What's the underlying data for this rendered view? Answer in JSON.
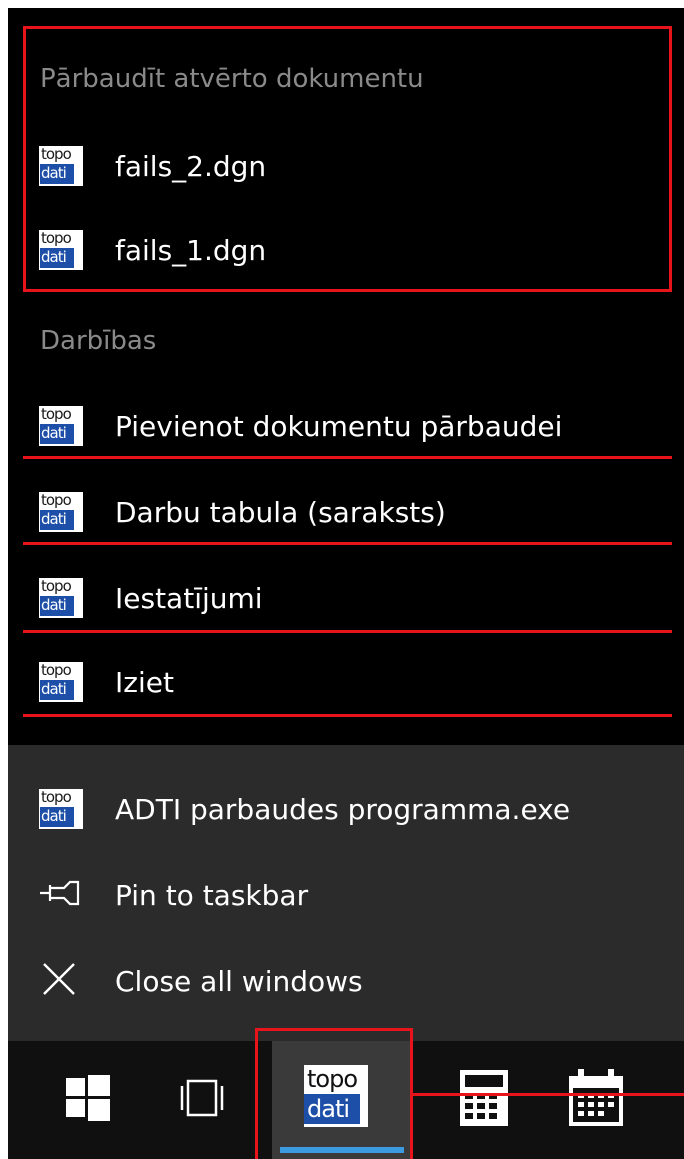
{
  "jumplist": {
    "recent_header": "Pārbaudīt atvērto dokumentu",
    "recent_items": [
      {
        "label": "fails_2.dgn",
        "icon": "topo-dati-icon"
      },
      {
        "label": "fails_1.dgn",
        "icon": "topo-dati-icon"
      }
    ],
    "tasks_header": "Darbības",
    "tasks": [
      {
        "label": "Pievienot dokumentu pārbaudei",
        "icon": "topo-dati-icon"
      },
      {
        "label": "Darbu tabula (saraksts)",
        "icon": "topo-dati-icon"
      },
      {
        "label": "Iestatījumi",
        "icon": "topo-dati-icon"
      },
      {
        "label": "Iziet",
        "icon": "topo-dati-icon"
      }
    ]
  },
  "app_actions": {
    "app_name": "ADTI parbaudes programma.exe",
    "pin_label": "Pin to taskbar",
    "close_label": "Close all windows"
  },
  "icon_text": {
    "top": "topo",
    "bottom": "dati"
  },
  "taskbar": {
    "buttons": [
      "windows-start-icon",
      "task-view-icon",
      "topo-dati-app-icon",
      "calculator-icon",
      "calendar-icon"
    ]
  },
  "colors": {
    "annotation_red": "#e8141c",
    "accent_blue": "#3c9be0",
    "brand_blue": "#1d4fa8"
  }
}
